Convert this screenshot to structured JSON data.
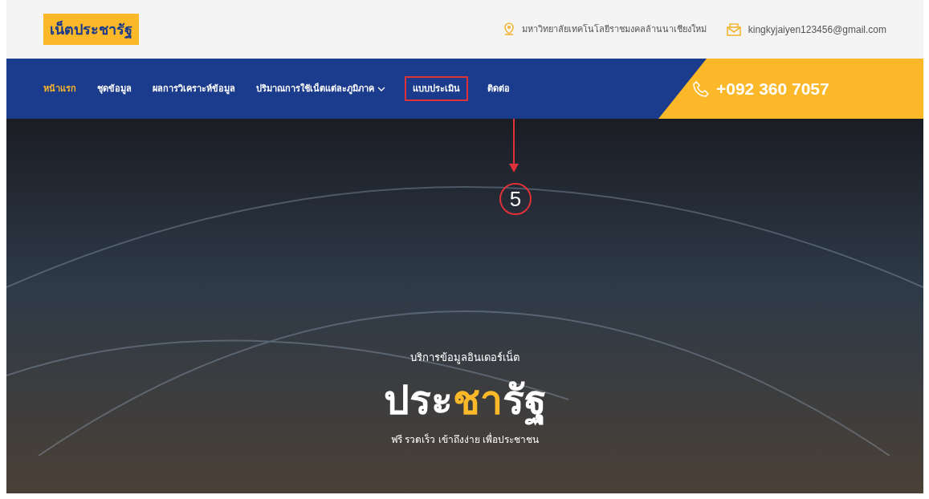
{
  "header": {
    "logo": "เน็ตประชารัฐ",
    "address": "มหาวิทยาลัยเทคโนโลยีราชมงคลล้านนาเชียงใหม่",
    "email": "kingkyjaiyen123456@gmail.com"
  },
  "nav": {
    "items": [
      {
        "label": "หน้าแรก",
        "selected": true,
        "dropdown": false,
        "annotated": false
      },
      {
        "label": "ชุดข้อมูล",
        "selected": false,
        "dropdown": false,
        "annotated": false
      },
      {
        "label": "ผลการวิเคราะห์ข้อมูล",
        "selected": false,
        "dropdown": false,
        "annotated": false
      },
      {
        "label": "ปริมาณการใช้เน็ตแต่ละภูมิภาค",
        "selected": false,
        "dropdown": true,
        "annotated": false
      },
      {
        "label": "แบบประเมิน",
        "selected": false,
        "dropdown": false,
        "annotated": true
      },
      {
        "label": "ติดต่อ",
        "selected": false,
        "dropdown": false,
        "annotated": false
      }
    ],
    "phone": "+092 360 7057"
  },
  "annotation": {
    "step": "5"
  },
  "hero": {
    "subtitle": "บริการข้อมูลอินเดอร์เน็ต",
    "title_parts": [
      {
        "text": "ประ",
        "highlight": false
      },
      {
        "text": "ชา",
        "highlight": true
      },
      {
        "text": "รัฐ",
        "highlight": false
      }
    ],
    "tagline": "ฟรี รวดเร็ว เข้าถึงง่าย เพื่อประชาชน"
  }
}
